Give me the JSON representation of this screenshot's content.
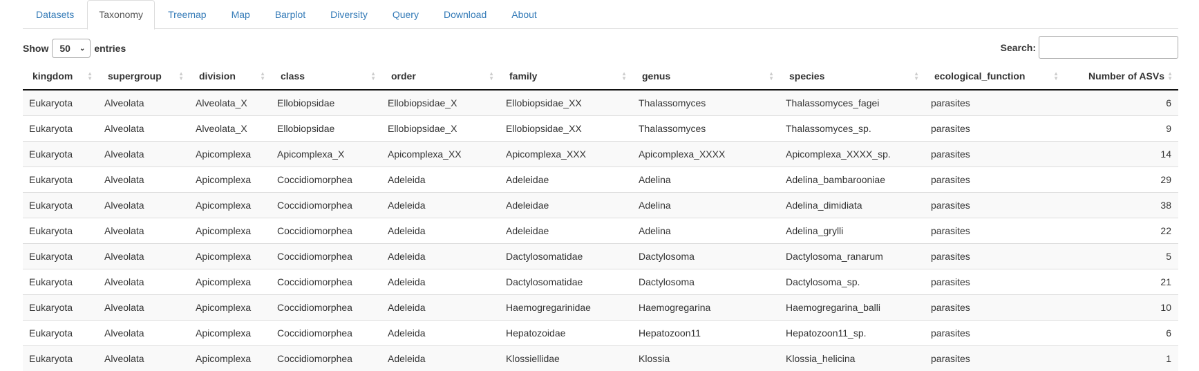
{
  "tabs": [
    "Datasets",
    "Taxonomy",
    "Treemap",
    "Map",
    "Barplot",
    "Diversity",
    "Query",
    "Download",
    "About"
  ],
  "active_tab": "Taxonomy",
  "length": {
    "show": "Show",
    "value": "50",
    "entries": "entries"
  },
  "search": {
    "label": "Search:",
    "value": ""
  },
  "columns": [
    "kingdom",
    "supergroup",
    "division",
    "class",
    "order",
    "family",
    "genus",
    "species",
    "ecological_function",
    "Number of ASVs"
  ],
  "rows": [
    [
      "Eukaryota",
      "Alveolata",
      "Alveolata_X",
      "Ellobiopsidae",
      "Ellobiopsidae_X",
      "Ellobiopsidae_XX",
      "Thalassomyces",
      "Thalassomyces_fagei",
      "parasites",
      "6"
    ],
    [
      "Eukaryota",
      "Alveolata",
      "Alveolata_X",
      "Ellobiopsidae",
      "Ellobiopsidae_X",
      "Ellobiopsidae_XX",
      "Thalassomyces",
      "Thalassomyces_sp.",
      "parasites",
      "9"
    ],
    [
      "Eukaryota",
      "Alveolata",
      "Apicomplexa",
      "Apicomplexa_X",
      "Apicomplexa_XX",
      "Apicomplexa_XXX",
      "Apicomplexa_XXXX",
      "Apicomplexa_XXXX_sp.",
      "parasites",
      "14"
    ],
    [
      "Eukaryota",
      "Alveolata",
      "Apicomplexa",
      "Coccidiomorphea",
      "Adeleida",
      "Adeleidae",
      "Adelina",
      "Adelina_bambarooniae",
      "parasites",
      "29"
    ],
    [
      "Eukaryota",
      "Alveolata",
      "Apicomplexa",
      "Coccidiomorphea",
      "Adeleida",
      "Adeleidae",
      "Adelina",
      "Adelina_dimidiata",
      "parasites",
      "38"
    ],
    [
      "Eukaryota",
      "Alveolata",
      "Apicomplexa",
      "Coccidiomorphea",
      "Adeleida",
      "Adeleidae",
      "Adelina",
      "Adelina_grylli",
      "parasites",
      "22"
    ],
    [
      "Eukaryota",
      "Alveolata",
      "Apicomplexa",
      "Coccidiomorphea",
      "Adeleida",
      "Dactylosomatidae",
      "Dactylosoma",
      "Dactylosoma_ranarum",
      "parasites",
      "5"
    ],
    [
      "Eukaryota",
      "Alveolata",
      "Apicomplexa",
      "Coccidiomorphea",
      "Adeleida",
      "Dactylosomatidae",
      "Dactylosoma",
      "Dactylosoma_sp.",
      "parasites",
      "21"
    ],
    [
      "Eukaryota",
      "Alveolata",
      "Apicomplexa",
      "Coccidiomorphea",
      "Adeleida",
      "Haemogregarinidae",
      "Haemogregarina",
      "Haemogregarina_balli",
      "parasites",
      "10"
    ],
    [
      "Eukaryota",
      "Alveolata",
      "Apicomplexa",
      "Coccidiomorphea",
      "Adeleida",
      "Hepatozoidae",
      "Hepatozoon11",
      "Hepatozoon11_sp.",
      "parasites",
      "6"
    ],
    [
      "Eukaryota",
      "Alveolata",
      "Apicomplexa",
      "Coccidiomorphea",
      "Adeleida",
      "Klossiellidae",
      "Klossia",
      "Klossia_helicina",
      "parasites",
      "1"
    ]
  ]
}
